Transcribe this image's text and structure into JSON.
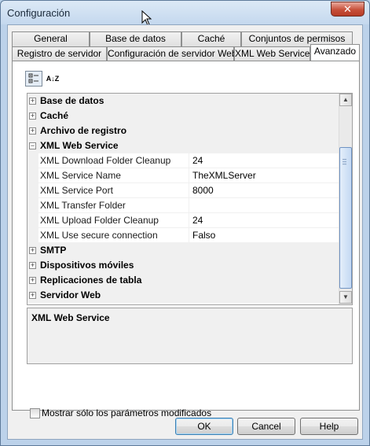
{
  "window": {
    "title": "Configuración",
    "close_glyph": "✕"
  },
  "tabs": {
    "row1": [
      "General",
      "Base de datos",
      "Caché",
      "Conjuntos de permisos"
    ],
    "row2": [
      "Registro de servidor",
      "Configuración de servidor Web",
      "XML Web Service",
      "Avanzado"
    ],
    "active": "Avanzado"
  },
  "toolbar": {
    "categorized_icon": "categorized-view-icon",
    "alphabetical_icon": "alphabetical-sort-icon",
    "alpha_glyph": "A↓Z"
  },
  "grid": {
    "collapsed_glyph": "+",
    "expanded_glyph": "−",
    "rows": [
      {
        "type": "category",
        "label": "Base de datos",
        "expanded": false
      },
      {
        "type": "category",
        "label": "Caché",
        "expanded": false
      },
      {
        "type": "category",
        "label": "Archivo de registro",
        "expanded": false
      },
      {
        "type": "category",
        "label": "XML Web Service",
        "expanded": true
      },
      {
        "type": "property",
        "name": "XML Download Folder Cleanup",
        "value": "24"
      },
      {
        "type": "property",
        "name": "XML Service Name",
        "value": "TheXMLServer"
      },
      {
        "type": "property",
        "name": "XML Service Port",
        "value": "8000"
      },
      {
        "type": "property",
        "name": "XML Transfer Folder",
        "value": ""
      },
      {
        "type": "property",
        "name": "XML Upload Folder Cleanup",
        "value": "24"
      },
      {
        "type": "property",
        "name": "XML Use secure connection",
        "value": "Falso"
      },
      {
        "type": "category",
        "label": "SMTP",
        "expanded": false
      },
      {
        "type": "category",
        "label": "Dispositivos móviles",
        "expanded": false
      },
      {
        "type": "category",
        "label": "Replicaciones de tabla",
        "expanded": false
      },
      {
        "type": "category",
        "label": "Servidor Web",
        "expanded": false
      }
    ]
  },
  "description": {
    "title": "XML Web Service"
  },
  "checkbox": {
    "label": "Mostrar sólo los parámetros modificados",
    "checked": false
  },
  "buttons": {
    "ok": "OK",
    "cancel": "Cancel",
    "help": "Help"
  }
}
